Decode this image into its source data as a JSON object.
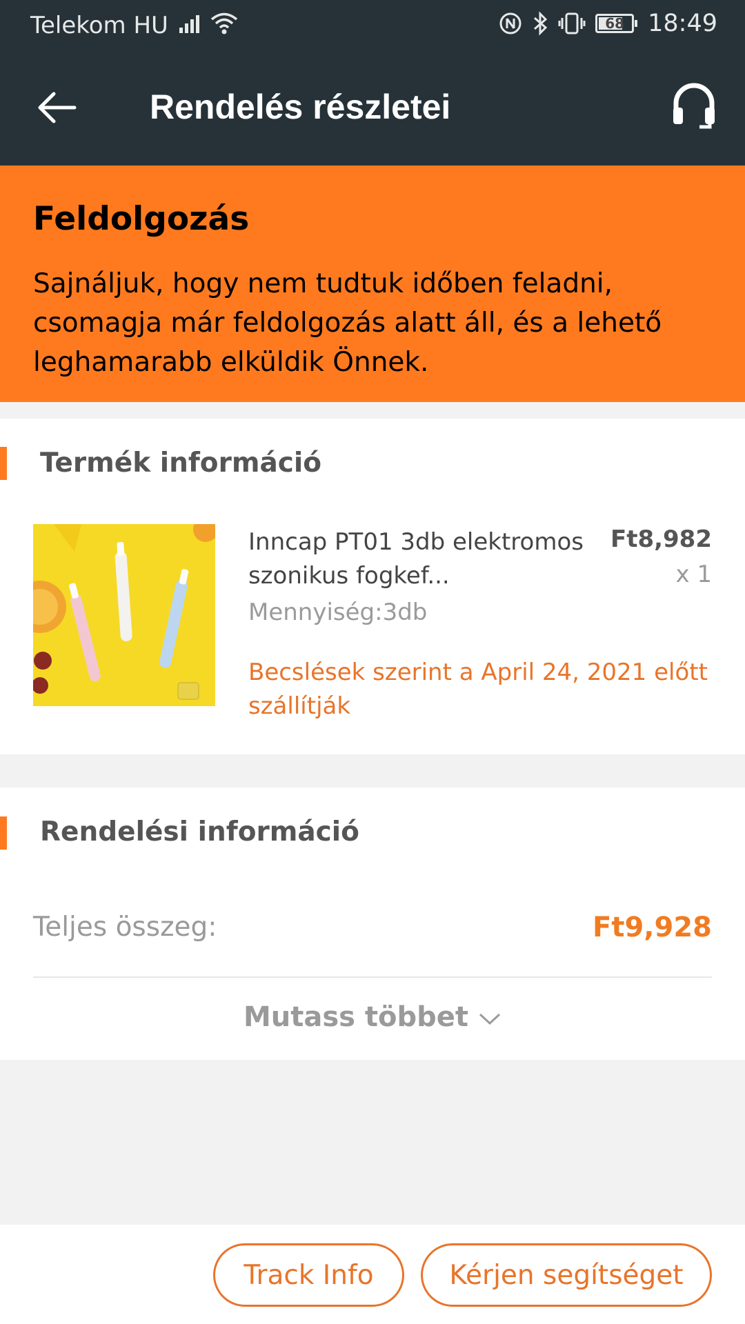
{
  "status_bar": {
    "carrier": "Telekom HU",
    "battery": "68",
    "time": "18:49"
  },
  "header": {
    "title": "Rendelés részletei",
    "back_icon": "arrow-left-icon",
    "support_icon": "headset-icon"
  },
  "banner": {
    "title": "Feldolgozás",
    "text": "Sajnáljuk, hogy nem tudtuk időben feladni, csomagja már feldolgozás alatt áll, és a lehető leghamarabb elküldik Önnek.",
    "color": "#ff7a1f"
  },
  "product_section": {
    "title": "Termék információ",
    "item": {
      "name": "Inncap PT01 3db elektromos szonikus fogkef...",
      "quantity": "Mennyiség:3db",
      "price": "Ft8,982",
      "count": "x 1",
      "estimate": "Becslések szerint a April 24, 2021 előtt szállítják"
    }
  },
  "order_section": {
    "title": "Rendelési információ",
    "total_label": "Teljes összeg:",
    "total_value": "Ft9,928",
    "show_more": "Mutass többet"
  },
  "actions": {
    "track": "Track Info",
    "help": "Kérjen segítséget"
  },
  "colors": {
    "header_bg": "#263238",
    "accent": "#ff7a1f",
    "button_text": "#e8742a"
  }
}
